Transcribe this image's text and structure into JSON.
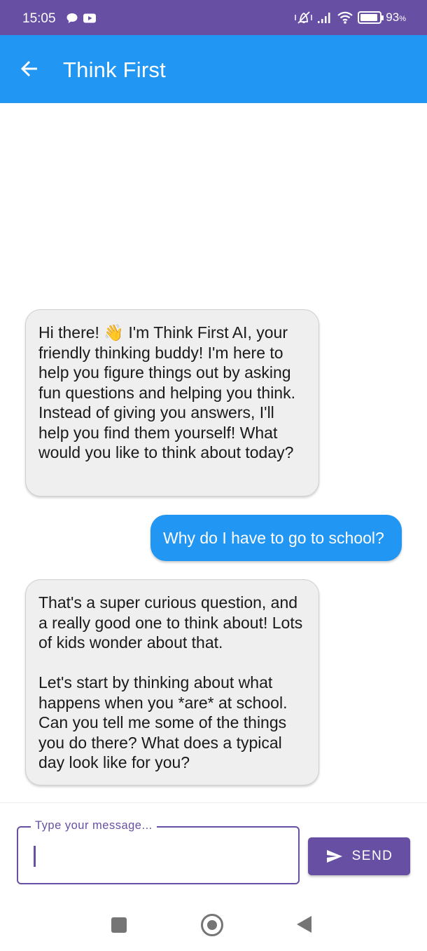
{
  "status_bar": {
    "time": "15:05",
    "battery_percent": "93",
    "battery_unit": "%",
    "battery_level": 0.93,
    "icons": [
      "chat-bubble-icon",
      "youtube-icon",
      "vibrate-off-icon",
      "signal-icon",
      "wifi-icon",
      "battery-icon"
    ]
  },
  "app_bar": {
    "title": "Think First",
    "back_icon": "arrow-left-icon",
    "color": "#2196f3"
  },
  "messages": [
    {
      "sender": "bot",
      "text": "Hi there! 👋 I'm Think First AI, your friendly thinking buddy! I'm here to help you figure things out by asking fun questions and helping you think. Instead of giving you answers, I'll help you find them yourself! What would you like to think about today?"
    },
    {
      "sender": "user",
      "text": "Why do I have to go to school?"
    },
    {
      "sender": "bot",
      "text": "That's a super curious question, and a really good one to think about! Lots of kids wonder about that.\n\nLet's start by thinking about what happens when you *are* at school. Can you tell me some of the things you do there? What does a typical day look like for you?"
    }
  ],
  "composer": {
    "label": "Type your message...",
    "value": "",
    "send_label": "SEND",
    "send_icon": "send-icon",
    "accent": "#6750a4"
  },
  "nav_bar": {
    "icons": [
      "recents-icon",
      "home-icon",
      "back-triangle-icon"
    ]
  }
}
